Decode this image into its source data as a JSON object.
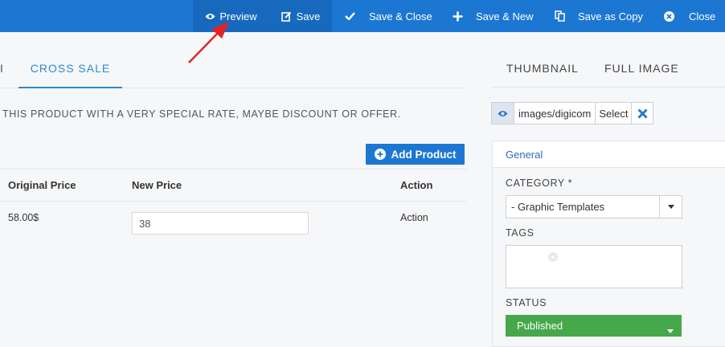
{
  "toolbar": {
    "preview": "Preview",
    "save": "Save",
    "save_close": "Save & Close",
    "save_new": "Save & New",
    "save_copy": "Save as Copy",
    "close": "Close"
  },
  "tabs": {
    "partial": "I",
    "cross_sale": "CROSS SALE"
  },
  "description": "THIS PRODUCT WITH A VERY SPECIAL RATE, MAYBE DISCOUNT OR OFFER.",
  "add_product": "Add Product",
  "table": {
    "headers": [
      "Original Price",
      "New Price",
      "Action"
    ],
    "rows": [
      {
        "original_price": "58.00$",
        "new_price": "38",
        "action": "Action"
      }
    ]
  },
  "right_tabs": [
    "THUMBNAIL",
    "FULL IMAGE"
  ],
  "image_field": {
    "path": "images/digicom",
    "select": "Select"
  },
  "general": {
    "title": "General",
    "category_label": "CATEGORY *",
    "category_value": "- Graphic Templates",
    "tags_label": "TAGS",
    "status_label": "STATUS",
    "status_value": "Published"
  },
  "colors": {
    "toolbar": "#1c77d2",
    "accent": "#2a8bd0",
    "published": "#46a84a",
    "arrow": "#e02424"
  }
}
